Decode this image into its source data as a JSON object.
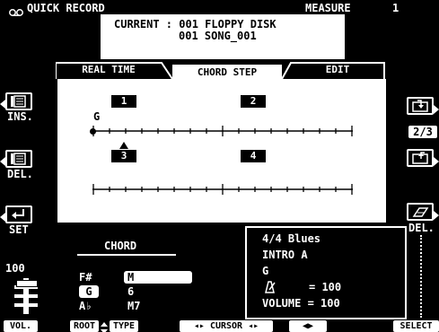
{
  "header": {
    "mode_title": "QUICK RECORD",
    "measure_label": "MEASURE",
    "measure_value": "1",
    "current_label": "CURRENT : 001 FLOPPY DISK",
    "song_name": "001 SONG_001"
  },
  "tabs": [
    {
      "label": "REAL TIME",
      "active": false
    },
    {
      "label": "CHORD STEP",
      "active": true
    },
    {
      "label": "EDIT",
      "active": false
    }
  ],
  "left_buttons": [
    {
      "label": "INS.",
      "icon": "insert-list-icon"
    },
    {
      "label": "DEL.",
      "icon": "delete-list-icon"
    },
    {
      "label": "SET",
      "icon": "enter-arrow-icon"
    }
  ],
  "right_buttons": [
    {
      "label": "",
      "icon": "save-disk-icon"
    },
    {
      "label": "2/3",
      "icon": "page-indicator"
    },
    {
      "label": "",
      "icon": "load-disk-icon"
    },
    {
      "label": "DEL.",
      "icon": "eraser-icon"
    }
  ],
  "step_grid": {
    "row1": {
      "measures": [
        "1",
        "2"
      ],
      "chord_at_start": "G"
    },
    "row2": {
      "measures": [
        "3",
        "4"
      ]
    },
    "cursor_measure": "3"
  },
  "chord_panel": {
    "title": "CHORD",
    "root_list": [
      "F#",
      "G",
      "A♭"
    ],
    "selected_root": "G",
    "type_list": [
      "M",
      "6",
      "M7"
    ],
    "selected_type": "M"
  },
  "volume": {
    "label": "VOL.",
    "value": "100"
  },
  "style_info": {
    "style_name": "4/4 Blues",
    "section": "INTRO A",
    "chord": "G",
    "tempo_label": "= 100",
    "volume_line": "VOLUME = 100"
  },
  "softkeys": {
    "vol": "VOL.",
    "root": "ROOT",
    "type": "TYPE",
    "cursor": "CURSOR",
    "select": "SELECT"
  }
}
